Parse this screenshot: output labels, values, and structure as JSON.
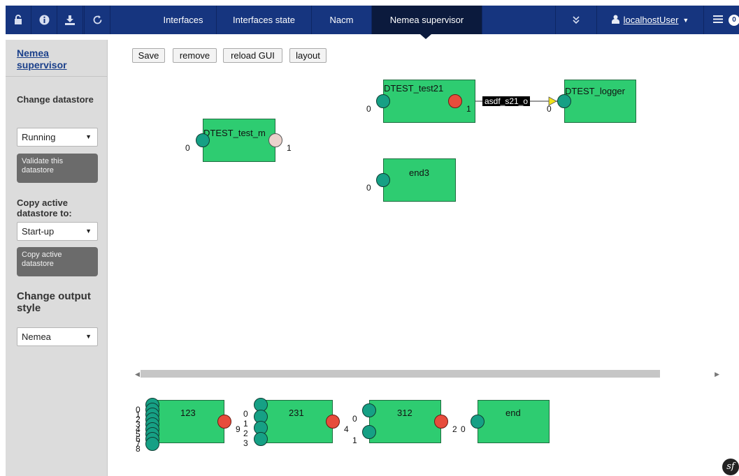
{
  "topnav": {
    "icons": [
      "lock-icon",
      "info-icon",
      "download-icon",
      "refresh-icon"
    ],
    "tabs": [
      {
        "label": "Interfaces"
      },
      {
        "label": "Interfaces state"
      },
      {
        "label": "Nacm"
      },
      {
        "label": "Nemea supervisor"
      }
    ],
    "active_tab": "Nemea supervisor",
    "more_icon": "double-chevron-down-icon",
    "user": {
      "name": "localhostUser"
    },
    "notification_count": "0"
  },
  "sidebar": {
    "title": "Nemea supervisor",
    "change_datastore": {
      "heading": "Change datastore",
      "selected": "Running",
      "button": "Validate this datastore"
    },
    "copy_datastore": {
      "heading": "Copy active datastore to:",
      "selected": "Start-up",
      "button": "Copy active datastore"
    },
    "output_style": {
      "heading": "Change output style",
      "selected": "Nemea"
    }
  },
  "toolbar": {
    "save": "Save",
    "remove": "remove",
    "reload": "reload GUI",
    "layout": "layout"
  },
  "canvas": {
    "modules": {
      "dtest_test21": {
        "title": "DTEST_test21",
        "in": "0",
        "out": "1"
      },
      "dtest_logger": {
        "title": "DTEST_logger",
        "in": "0"
      },
      "dtest_test_m": {
        "title": "DTEST_test_m",
        "in": "0",
        "out": "1"
      },
      "end3": {
        "title": "end3",
        "in": "0"
      }
    },
    "connection": {
      "label": "asdf_s21_o"
    }
  },
  "bottom": {
    "m123": {
      "title": "123",
      "ins": [
        "0",
        "1",
        "2",
        "3",
        "4",
        "5",
        "6",
        "7",
        "8"
      ],
      "out": "9"
    },
    "m231": {
      "title": "231",
      "ins": [
        "0",
        "1",
        "2",
        "3"
      ],
      "out": "4"
    },
    "m312": {
      "title": "312",
      "ins": [
        "0",
        "1"
      ],
      "out": "2"
    },
    "end": {
      "title": "end",
      "in": "0"
    }
  },
  "footer": {
    "logo_text": "sf"
  }
}
